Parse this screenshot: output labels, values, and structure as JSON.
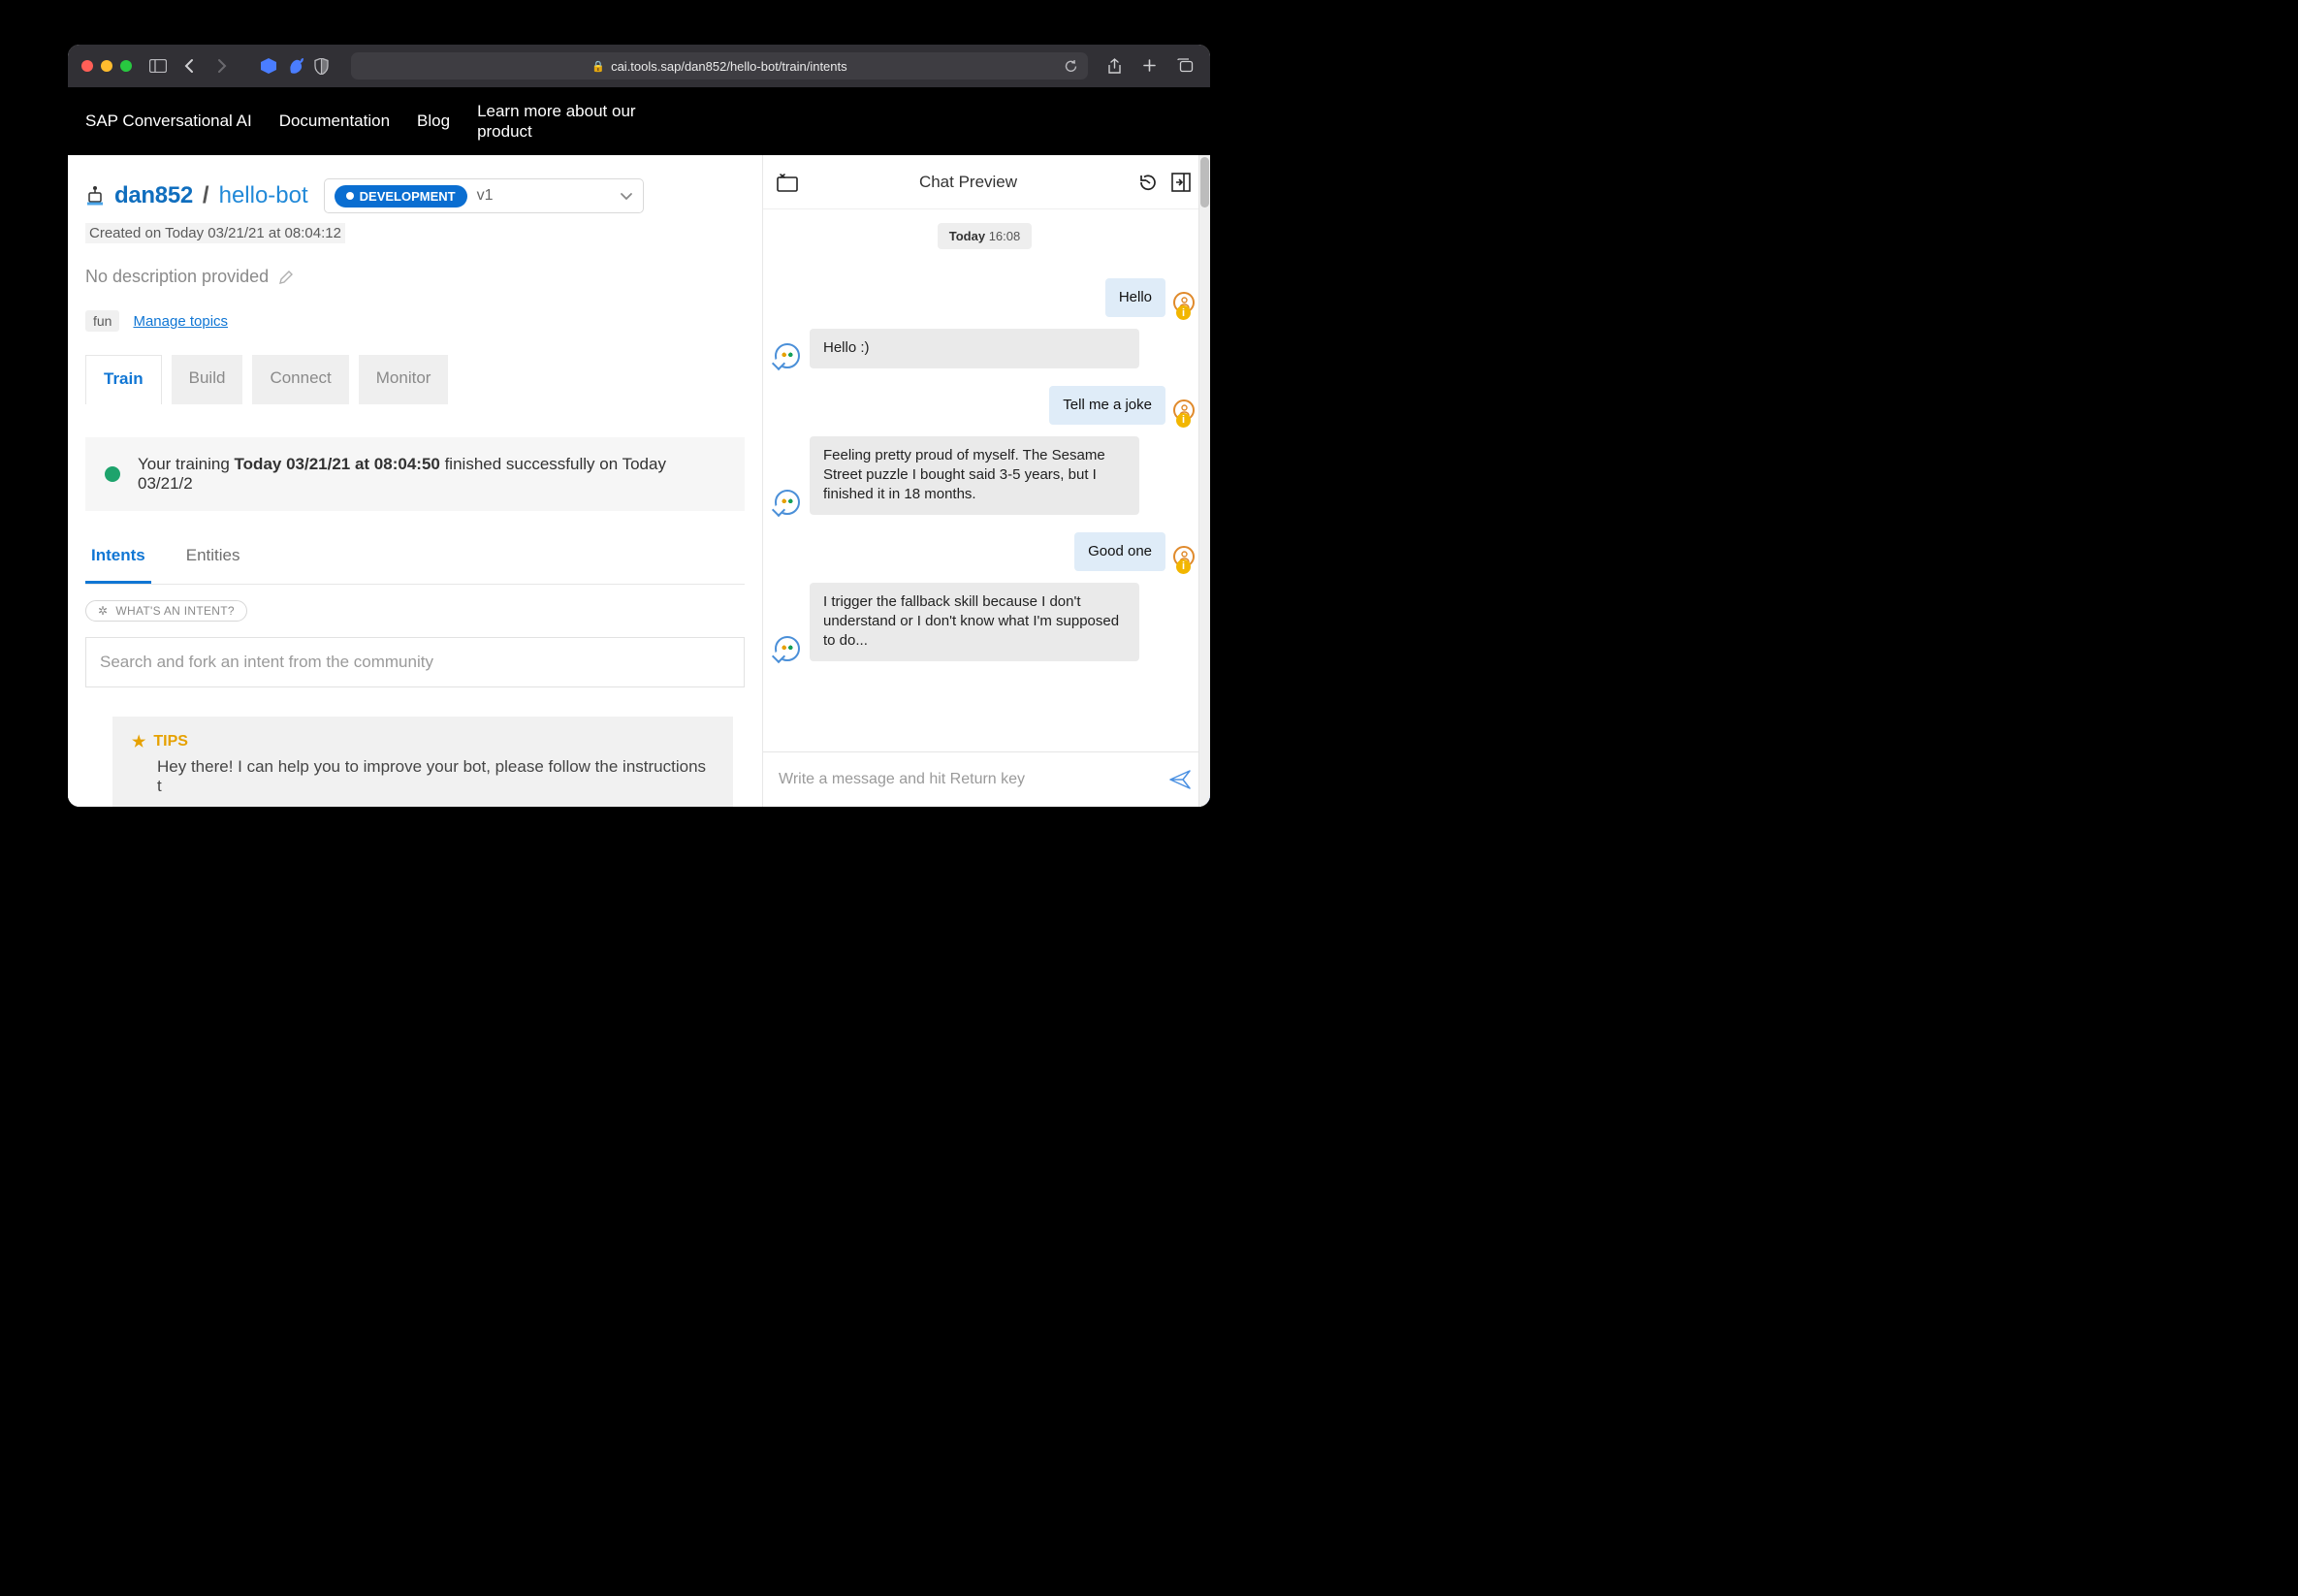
{
  "browser": {
    "url": "cai.tools.sap/dan852/hello-bot/train/intents"
  },
  "nav": {
    "brand": "SAP Conversational AI",
    "links": {
      "docs": "Documentation",
      "blog": "Blog",
      "learn": "Learn more about our product"
    }
  },
  "breadcrumb": {
    "user": "dan852",
    "bot": "hello-bot",
    "env": "DEVELOPMENT",
    "version": "v1"
  },
  "meta": {
    "created": "Created on Today 03/21/21 at 08:04:12",
    "description": "No description provided",
    "topic1": "fun",
    "manage": "Manage topics"
  },
  "tabs": {
    "train": "Train",
    "build": "Build",
    "connect": "Connect",
    "monitor": "Monitor"
  },
  "status": {
    "prefix": "Your training ",
    "bold": "Today 03/21/21 at 08:04:50",
    "suffix": " finished successfully on Today 03/21/2"
  },
  "subtabs": {
    "intents": "Intents",
    "entities": "Entities"
  },
  "help": {
    "whats": "WHAT'S AN INTENT?"
  },
  "search": {
    "placeholder": "Search and fork an intent from the community"
  },
  "tips": {
    "title": "TIPS",
    "body": "Hey there! I can help you to improve your bot, please follow the instructions t"
  },
  "chat": {
    "title": "Chat Preview",
    "date_label": "Today",
    "date_time": "16:08",
    "messages": {
      "m1": "Hello",
      "m2": "Hello :)",
      "m3": "Tell me a joke",
      "m4": "Feeling pretty proud of myself. The Sesame Street puzzle I bought said 3-5 years, but I finished it in 18 months.",
      "m5": "Good one",
      "m6": "I trigger the fallback skill because I don't understand or I don't know what I'm supposed to do..."
    },
    "input_placeholder": "Write a message and hit Return key"
  }
}
